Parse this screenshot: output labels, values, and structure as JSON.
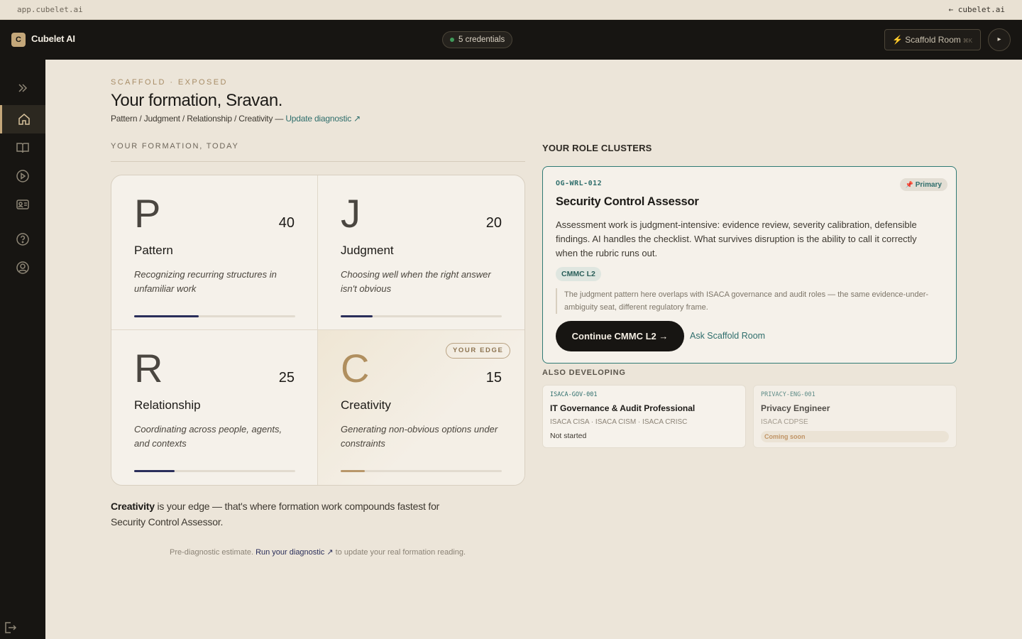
{
  "browser": {
    "url": "app.cubelet.ai",
    "back_link": "← cubelet.ai"
  },
  "topbar": {
    "logo_mark": "C",
    "app_name": "Cubelet AI",
    "credentials_pill": "5 credentials",
    "scaffold_button": "⚡ Scaffold Room",
    "scaffold_shortcut": "⌘K",
    "collapse_icon": "▸"
  },
  "sidebar": {
    "items": [
      {
        "name": "expand-icon"
      },
      {
        "name": "home-icon",
        "active": true
      },
      {
        "name": "book-icon"
      },
      {
        "name": "play-icon"
      },
      {
        "name": "id-card-icon"
      },
      {
        "name": "help-icon"
      },
      {
        "name": "user-icon"
      }
    ],
    "logout_icon": "logout-icon"
  },
  "header": {
    "eyebrow": "SCAFFOLD · EXPOSED",
    "title": "Your formation, Sravan.",
    "subline": "Pattern / Judgment / Relationship / Creativity —",
    "update_link": "Update diagnostic ↗"
  },
  "formation": {
    "section_label": "YOUR FORMATION, TODAY",
    "dimensions": [
      {
        "letter": "P",
        "score": "40",
        "name": "Pattern",
        "description": "Recognizing recurring structures in unfamiliar work",
        "progress": 0.4
      },
      {
        "letter": "J",
        "score": "20",
        "name": "Judgment",
        "description": "Choosing well when the right answer isn't obvious",
        "progress": 0.2
      },
      {
        "letter": "R",
        "score": "25",
        "name": "Relationship",
        "description": "Coordinating across people, agents, and contexts",
        "progress": 0.25
      },
      {
        "letter": "C",
        "score": "15",
        "name": "Creativity",
        "description": "Generating non-obvious options under constraints",
        "progress": 0.15,
        "badge": "YOUR EDGE"
      }
    ],
    "summary_bold": "Creativity",
    "summary_rest": " is your edge — that's where formation work compounds fastest for Security Control Assessor.",
    "footnote_pre": "Pre-diagnostic estimate. ",
    "footnote_link": "Run your diagnostic ↗",
    "footnote_post": " to update your real formation reading."
  },
  "clusters": {
    "title": "YOUR ROLE CLUSTERS",
    "primary": {
      "code": "OG-WRL-012",
      "tag": "Primary",
      "tag_icon": "📌",
      "title": "Security Control Assessor",
      "body": "Assessment work is judgment-intensive: evidence review, severity calibration, defensible findings. AI handles the checklist. What survives disruption is the ability to call it correctly when the rubric runs out.",
      "chip": "CMMC L2",
      "quote": "The judgment pattern here overlaps with ISACA governance and audit roles — the same evidence-under-ambiguity seat, different regulatory frame.",
      "cta": "Continue CMMC L2 →",
      "ask_link": "Ask Scaffold Room"
    },
    "also_title": "ALSO DEVELOPING",
    "others": [
      {
        "code": "ISACA-GOV-001",
        "title": "IT Governance & Audit Professional",
        "certs": "ISACA CISA · ISACA CISM · ISACA CRISC",
        "status": "Not started"
      },
      {
        "code": "PRIVACY-ENG-001",
        "title": "Privacy Engineer",
        "certs": "ISACA CDPSE",
        "status": "Coming soon"
      }
    ]
  },
  "colors": {
    "accent_teal": "#2f6e6c",
    "gold": "#b08f5f",
    "navy_bar": "#2a2e5a",
    "dark": "#171512"
  }
}
